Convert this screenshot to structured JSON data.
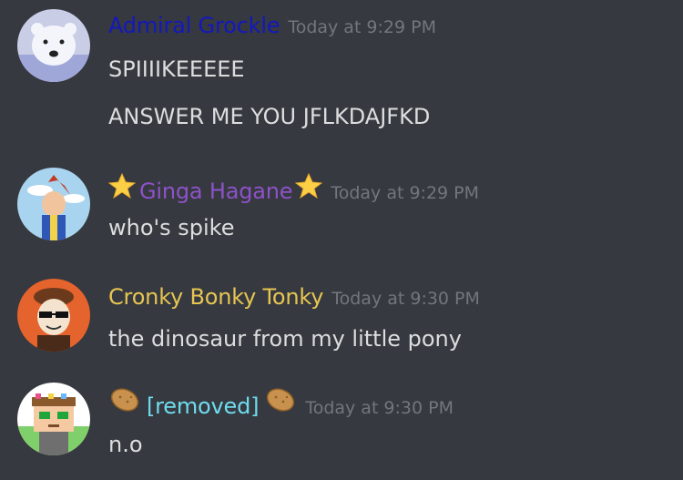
{
  "messages": [
    {
      "username": "Admiral Grockle",
      "timestamp": "Today at 9:29 PM",
      "lines": [
        "SPIIIIKEEEEE",
        "ANSWER ME YOU JFLKDAJFKD"
      ],
      "name_color": "#1418bd",
      "avatar_icon": "polar-bear-avatar"
    },
    {
      "username": "Ginga Hagane",
      "timestamp": "Today at 9:29 PM",
      "lines": [
        "who's spike"
      ],
      "name_color": "#8d52c8",
      "name_prefix_icon": "star-icon",
      "name_suffix_icon": "star-icon",
      "avatar_icon": "anime-boy-avatar"
    },
    {
      "username": "Cronky Bonky Tonky",
      "timestamp": "Today at 9:30 PM",
      "lines": [
        "the dinosaur from my little pony"
      ],
      "name_color": "#e7c552",
      "avatar_icon": "sunglasses-guy-avatar"
    },
    {
      "username": "[removed]",
      "timestamp": "Today at 9:30 PM",
      "lines": [
        "n.o"
      ],
      "name_color": "#6fdcef",
      "name_prefix_icon": "potato-icon",
      "name_suffix_icon": "potato-icon",
      "avatar_icon": "pixel-character-avatar"
    }
  ]
}
